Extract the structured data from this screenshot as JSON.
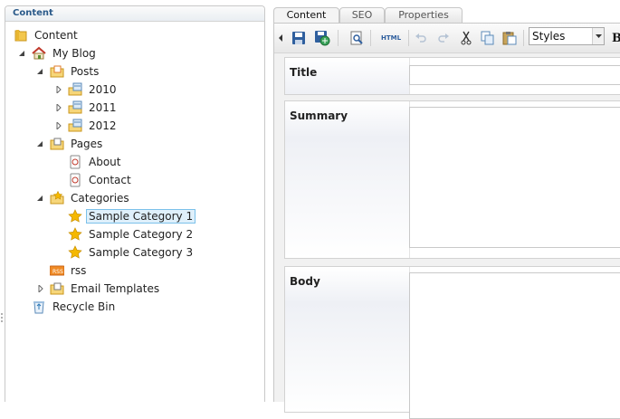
{
  "tree": {
    "header": "Content",
    "nodes": [
      {
        "label": "Content",
        "icon": "content-root-folder-icon",
        "arrow": "none"
      },
      {
        "label": "My Blog",
        "icon": "home-icon",
        "arrow": "expanded"
      },
      {
        "label": "Posts",
        "icon": "folder-icon",
        "arrow": "expanded"
      },
      {
        "label": "2010",
        "icon": "date-folder-icon",
        "arrow": "collapsed"
      },
      {
        "label": "2011",
        "icon": "date-folder-icon",
        "arrow": "collapsed"
      },
      {
        "label": "2012",
        "icon": "date-folder-icon",
        "arrow": "collapsed"
      },
      {
        "label": "Pages",
        "icon": "folder-icon",
        "arrow": "expanded"
      },
      {
        "label": "About",
        "icon": "page-icon",
        "arrow": "none"
      },
      {
        "label": "Contact",
        "icon": "page-icon",
        "arrow": "none"
      },
      {
        "label": "Categories",
        "icon": "folder-star-icon",
        "arrow": "expanded"
      },
      {
        "label": "Sample Category 1",
        "icon": "star-icon",
        "arrow": "none",
        "selected": true
      },
      {
        "label": "Sample Category 2",
        "icon": "star-icon",
        "arrow": "none"
      },
      {
        "label": "Sample Category 3",
        "icon": "star-icon",
        "arrow": "none"
      },
      {
        "label": "rss",
        "icon": "rss-icon",
        "arrow": "none"
      },
      {
        "label": "Email Templates",
        "icon": "folder-icon",
        "arrow": "collapsed"
      },
      {
        "label": "Recycle Bin",
        "icon": "recycle-bin-icon",
        "arrow": "none"
      }
    ]
  },
  "tabs": [
    {
      "label": "Content",
      "active": true
    },
    {
      "label": "SEO",
      "active": false
    },
    {
      "label": "Properties",
      "active": false
    }
  ],
  "toolbar": {
    "styles_value": "Styles",
    "html_label": "HTML",
    "bold_label": "B"
  },
  "fields": {
    "title_label": "Title",
    "summary_label": "Summary",
    "body_label": "Body"
  },
  "colors": {
    "header_text": "#2a5a8a",
    "selection_bg": "#dff0fb",
    "selection_border": "#7cc1ea",
    "folder": "#f3c74d",
    "star": "#f5b800"
  }
}
